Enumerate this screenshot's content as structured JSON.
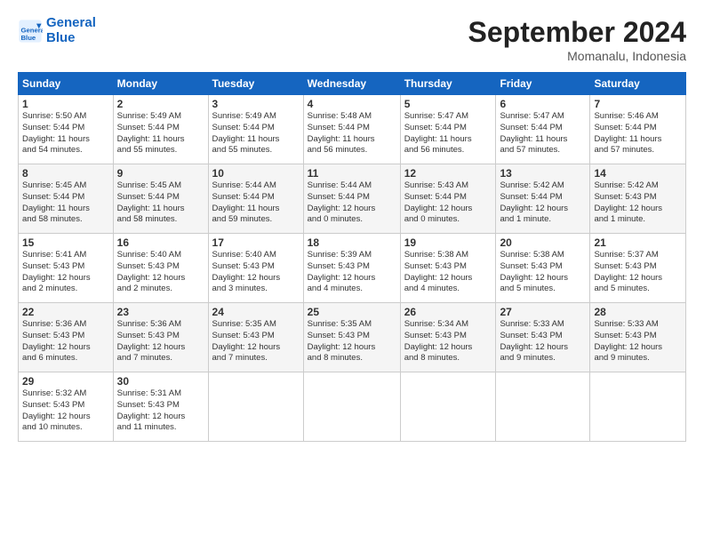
{
  "header": {
    "logo_line1": "General",
    "logo_line2": "Blue",
    "month": "September 2024",
    "location": "Momanalu, Indonesia"
  },
  "days_of_week": [
    "Sunday",
    "Monday",
    "Tuesday",
    "Wednesday",
    "Thursday",
    "Friday",
    "Saturday"
  ],
  "weeks": [
    [
      {
        "day": "1",
        "info": "Sunrise: 5:50 AM\nSunset: 5:44 PM\nDaylight: 11 hours\nand 54 minutes."
      },
      {
        "day": "2",
        "info": "Sunrise: 5:49 AM\nSunset: 5:44 PM\nDaylight: 11 hours\nand 55 minutes."
      },
      {
        "day": "3",
        "info": "Sunrise: 5:49 AM\nSunset: 5:44 PM\nDaylight: 11 hours\nand 55 minutes."
      },
      {
        "day": "4",
        "info": "Sunrise: 5:48 AM\nSunset: 5:44 PM\nDaylight: 11 hours\nand 56 minutes."
      },
      {
        "day": "5",
        "info": "Sunrise: 5:47 AM\nSunset: 5:44 PM\nDaylight: 11 hours\nand 56 minutes."
      },
      {
        "day": "6",
        "info": "Sunrise: 5:47 AM\nSunset: 5:44 PM\nDaylight: 11 hours\nand 57 minutes."
      },
      {
        "day": "7",
        "info": "Sunrise: 5:46 AM\nSunset: 5:44 PM\nDaylight: 11 hours\nand 57 minutes."
      }
    ],
    [
      {
        "day": "8",
        "info": "Sunrise: 5:45 AM\nSunset: 5:44 PM\nDaylight: 11 hours\nand 58 minutes."
      },
      {
        "day": "9",
        "info": "Sunrise: 5:45 AM\nSunset: 5:44 PM\nDaylight: 11 hours\nand 58 minutes."
      },
      {
        "day": "10",
        "info": "Sunrise: 5:44 AM\nSunset: 5:44 PM\nDaylight: 11 hours\nand 59 minutes."
      },
      {
        "day": "11",
        "info": "Sunrise: 5:44 AM\nSunset: 5:44 PM\nDaylight: 12 hours\nand 0 minutes."
      },
      {
        "day": "12",
        "info": "Sunrise: 5:43 AM\nSunset: 5:44 PM\nDaylight: 12 hours\nand 0 minutes."
      },
      {
        "day": "13",
        "info": "Sunrise: 5:42 AM\nSunset: 5:44 PM\nDaylight: 12 hours\nand 1 minute."
      },
      {
        "day": "14",
        "info": "Sunrise: 5:42 AM\nSunset: 5:43 PM\nDaylight: 12 hours\nand 1 minute."
      }
    ],
    [
      {
        "day": "15",
        "info": "Sunrise: 5:41 AM\nSunset: 5:43 PM\nDaylight: 12 hours\nand 2 minutes."
      },
      {
        "day": "16",
        "info": "Sunrise: 5:40 AM\nSunset: 5:43 PM\nDaylight: 12 hours\nand 2 minutes."
      },
      {
        "day": "17",
        "info": "Sunrise: 5:40 AM\nSunset: 5:43 PM\nDaylight: 12 hours\nand 3 minutes."
      },
      {
        "day": "18",
        "info": "Sunrise: 5:39 AM\nSunset: 5:43 PM\nDaylight: 12 hours\nand 4 minutes."
      },
      {
        "day": "19",
        "info": "Sunrise: 5:38 AM\nSunset: 5:43 PM\nDaylight: 12 hours\nand 4 minutes."
      },
      {
        "day": "20",
        "info": "Sunrise: 5:38 AM\nSunset: 5:43 PM\nDaylight: 12 hours\nand 5 minutes."
      },
      {
        "day": "21",
        "info": "Sunrise: 5:37 AM\nSunset: 5:43 PM\nDaylight: 12 hours\nand 5 minutes."
      }
    ],
    [
      {
        "day": "22",
        "info": "Sunrise: 5:36 AM\nSunset: 5:43 PM\nDaylight: 12 hours\nand 6 minutes."
      },
      {
        "day": "23",
        "info": "Sunrise: 5:36 AM\nSunset: 5:43 PM\nDaylight: 12 hours\nand 7 minutes."
      },
      {
        "day": "24",
        "info": "Sunrise: 5:35 AM\nSunset: 5:43 PM\nDaylight: 12 hours\nand 7 minutes."
      },
      {
        "day": "25",
        "info": "Sunrise: 5:35 AM\nSunset: 5:43 PM\nDaylight: 12 hours\nand 8 minutes."
      },
      {
        "day": "26",
        "info": "Sunrise: 5:34 AM\nSunset: 5:43 PM\nDaylight: 12 hours\nand 8 minutes."
      },
      {
        "day": "27",
        "info": "Sunrise: 5:33 AM\nSunset: 5:43 PM\nDaylight: 12 hours\nand 9 minutes."
      },
      {
        "day": "28",
        "info": "Sunrise: 5:33 AM\nSunset: 5:43 PM\nDaylight: 12 hours\nand 9 minutes."
      }
    ],
    [
      {
        "day": "29",
        "info": "Sunrise: 5:32 AM\nSunset: 5:43 PM\nDaylight: 12 hours\nand 10 minutes."
      },
      {
        "day": "30",
        "info": "Sunrise: 5:31 AM\nSunset: 5:43 PM\nDaylight: 12 hours\nand 11 minutes."
      },
      {
        "day": "",
        "info": ""
      },
      {
        "day": "",
        "info": ""
      },
      {
        "day": "",
        "info": ""
      },
      {
        "day": "",
        "info": ""
      },
      {
        "day": "",
        "info": ""
      }
    ]
  ]
}
